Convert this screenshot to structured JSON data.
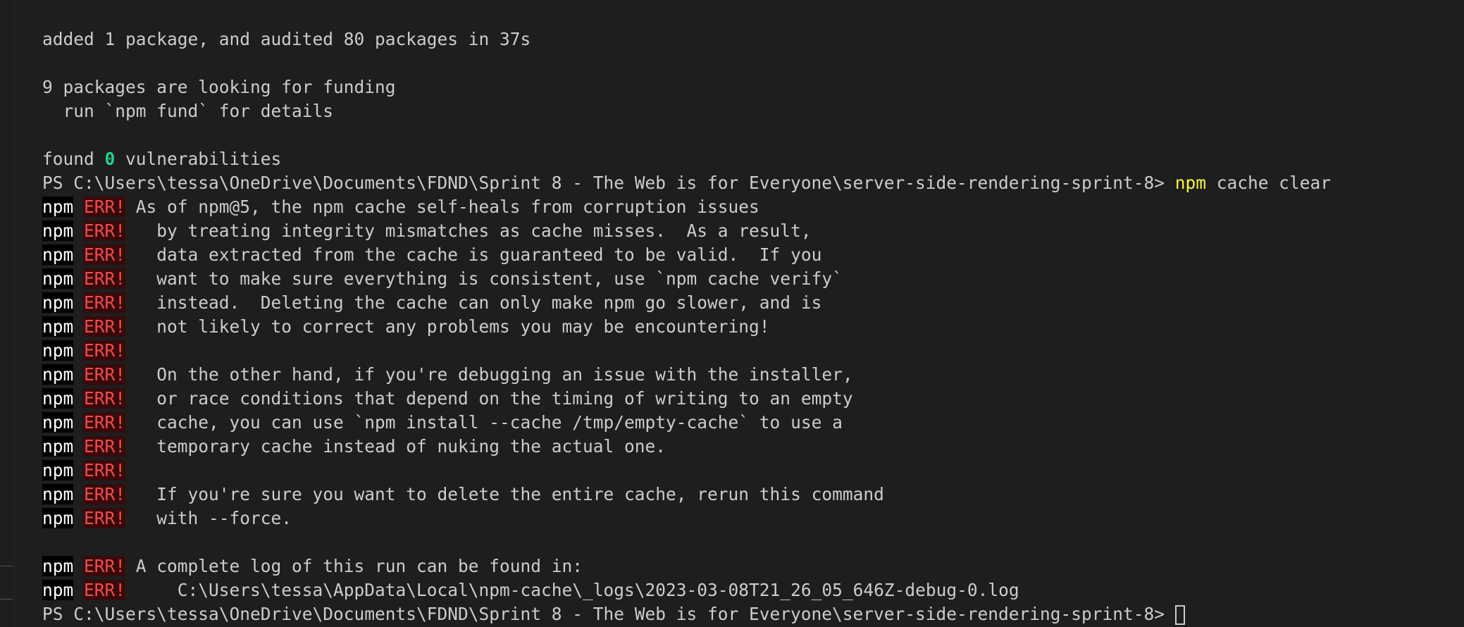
{
  "terminal": {
    "install": {
      "summary": "added 1 package, and audited 80 packages in 37s",
      "funding": "9 packages are looking for funding",
      "fund_hint": "  run `npm fund` for details",
      "found_prefix": "found ",
      "vulnerability_count": "0",
      "found_suffix": " vulnerabilities"
    },
    "prompt_path": "PS C:\\Users\\tessa\\OneDrive\\Documents\\FDND\\Sprint 8 - The Web is for Everyone\\server-side-rendering-sprint-8> ",
    "command_name": "npm",
    "command_args": " cache clear",
    "npm_label": "npm",
    "err_label": "ERR!",
    "error_lines": [
      " As of npm@5, the npm cache self-heals from corruption issues",
      "   by treating integrity mismatches as cache misses.  As a result,",
      "   data extracted from the cache is guaranteed to be valid.  If you",
      "   want to make sure everything is consistent, use `npm cache verify`",
      "   instead.  Deleting the cache can only make npm go slower, and is",
      "   not likely to correct any problems you may be encountering!",
      "",
      "   On the other hand, if you're debugging an issue with the installer,",
      "   or race conditions that depend on the timing of writing to an empty",
      "   cache, you can use `npm install --cache /tmp/empty-cache` to use a",
      "   temporary cache instead of nuking the actual one.",
      "",
      "   If you're sure you want to delete the entire cache, rerun this command",
      "   with --force."
    ],
    "log_lines": [
      " A complete log of this run can be found in:",
      "     C:\\Users\\tessa\\AppData\\Local\\npm-cache\\_logs\\2023-03-08T21_26_05_646Z-debug-0.log"
    ],
    "final_prompt": "PS C:\\Users\\tessa\\OneDrive\\Documents\\FDND\\Sprint 8 - The Web is for Everyone\\server-side-rendering-sprint-8> "
  }
}
